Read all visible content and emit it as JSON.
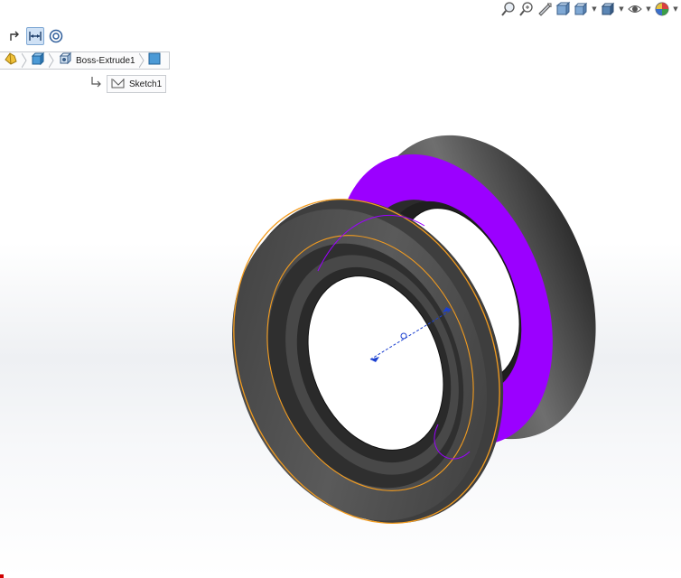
{
  "breadcrumb": {
    "items": [
      {
        "label": "",
        "icon": "part-icon"
      },
      {
        "label": "",
        "icon": "body-icon"
      },
      {
        "label": "Boss-Extrude1",
        "icon": "extrude-icon"
      },
      {
        "label": "",
        "icon": "face-icon"
      }
    ],
    "sketch_label": "Sketch1"
  },
  "selection_toolbar": {
    "items": [
      "normal-to-icon",
      "distance-icon",
      "concentric-icon"
    ]
  },
  "heads_up_toolbar": {
    "items": [
      "zoom-to-fit-icon",
      "zoom-to-area-icon",
      "previous-view-icon",
      "section-view-icon",
      "view-orientation-icon",
      "display-style-icon",
      "hide-show-items-icon",
      "edit-appearance-icon",
      "apply-scene-icon"
    ]
  },
  "colors": {
    "selected_face": "#9b00ff",
    "model_body": "#4a4a4a",
    "edge_highlight": "#f39c1f",
    "sketch_preview": "#1a3fd0"
  }
}
